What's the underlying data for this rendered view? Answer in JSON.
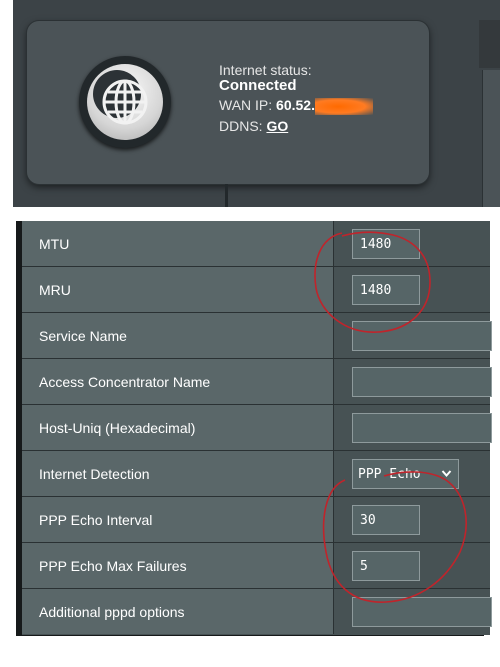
{
  "status": {
    "label": "Internet status:",
    "state": "Connected",
    "wan_ip_label": "WAN IP:",
    "wan_ip_value": "60.52.",
    "ddns_label": "DDNS:",
    "ddns_link": "GO"
  },
  "settings": {
    "rows": [
      {
        "label": "MTU",
        "value": "1480"
      },
      {
        "label": "MRU",
        "value": "1480"
      },
      {
        "label": "Service Name",
        "value": ""
      },
      {
        "label": "Access Concentrator Name",
        "value": ""
      },
      {
        "label": "Host-Uniq (Hexadecimal)",
        "value": ""
      },
      {
        "label": "Internet Detection",
        "value": "PPP Echo"
      },
      {
        "label": "PPP Echo Interval",
        "value": "30"
      },
      {
        "label": "PPP Echo Max Failures",
        "value": "5"
      },
      {
        "label": "Additional pppd options",
        "value": ""
      }
    ]
  },
  "icons": {
    "globe": "globe-icon",
    "dropdown": "chevron-down-icon"
  },
  "colors": {
    "annotation": "#c0242b",
    "redaction": "#ff7a1a"
  }
}
